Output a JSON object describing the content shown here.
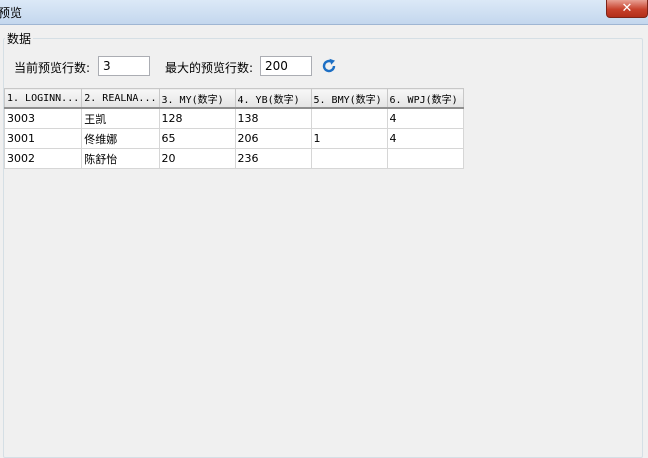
{
  "window": {
    "title": "预览",
    "close_label": "✕"
  },
  "group": {
    "label": "数据"
  },
  "preview": {
    "current_rows_label": "当前预览行数:",
    "current_rows_value": "3",
    "max_rows_label": "最大的预览行数:",
    "max_rows_value": "200",
    "refresh_icon": "refresh-icon"
  },
  "table": {
    "columns": [
      "1. LOGINN...",
      "2. REALNA...",
      "3. MY(数字)",
      "4. YB(数字)",
      "5. BMY(数字)",
      "6. WPJ(数字)"
    ],
    "rows": [
      [
        "3003",
        "王凯",
        "128",
        "138",
        "",
        "4"
      ],
      [
        "3001",
        "佟维娜",
        "65",
        "206",
        "1",
        "4"
      ],
      [
        "3002",
        "陈舒怡",
        "20",
        "236",
        "",
        ""
      ]
    ]
  }
}
